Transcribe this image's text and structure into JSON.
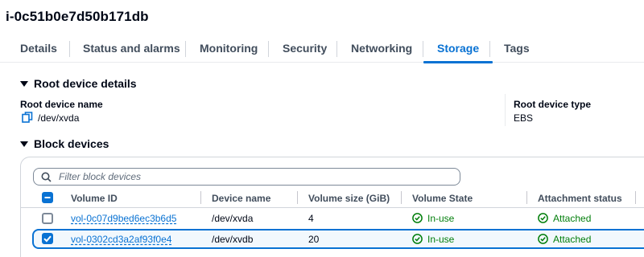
{
  "instance_id": "i-0c51b0e7d50b171db",
  "tabs": [
    {
      "label": "Details"
    },
    {
      "label": "Status and alarms"
    },
    {
      "label": "Monitoring"
    },
    {
      "label": "Security"
    },
    {
      "label": "Networking"
    },
    {
      "label": "Storage",
      "active": true
    },
    {
      "label": "Tags"
    }
  ],
  "root_device": {
    "section_title": "Root device details",
    "name_label": "Root device name",
    "name_value": "/dev/xvda",
    "type_label": "Root device type",
    "type_value": "EBS"
  },
  "block_devices": {
    "section_title": "Block devices",
    "filter_placeholder": "Filter block devices",
    "columns": [
      "Volume ID",
      "Device name",
      "Volume size (GiB)",
      "Volume State",
      "Attachment status"
    ],
    "rows": [
      {
        "volume_id": "vol-0c07d9bed6ec3b6d5",
        "device": "/dev/xvda",
        "size": "4",
        "state": "In-use",
        "attachment": "Attached",
        "selected": false
      },
      {
        "volume_id": "vol-0302cd3a2af93f0e4",
        "device": "/dev/xvdb",
        "size": "20",
        "state": "In-use",
        "attachment": "Attached",
        "selected": true
      }
    ]
  },
  "colors": {
    "accent": "#0972d3",
    "success": "#037f0c"
  },
  "icons": {
    "copy": "copy-icon",
    "search": "search-icon",
    "status": "check-circle-icon"
  }
}
